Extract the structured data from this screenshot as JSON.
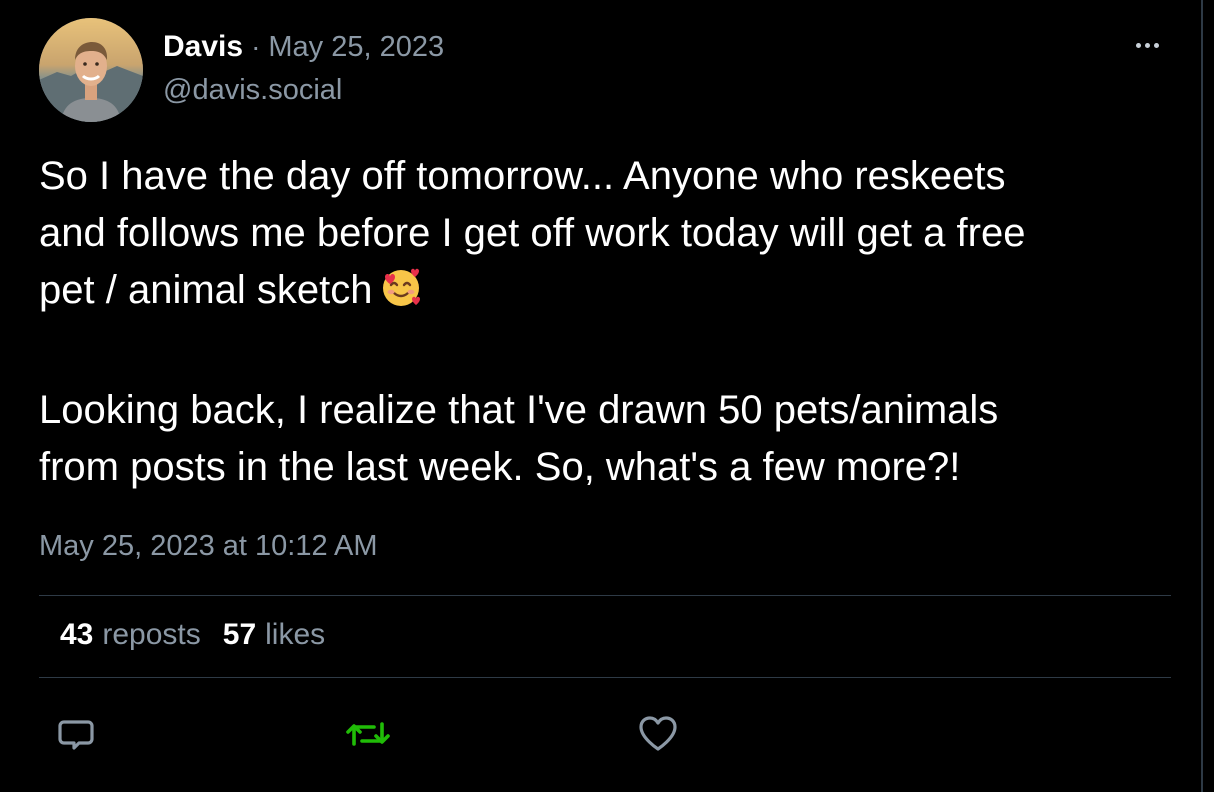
{
  "author": {
    "display_name": "Davis",
    "separator": "·",
    "post_date": "May 25, 2023",
    "handle": "@davis.social"
  },
  "post": {
    "paragraph_1_line_1": "So I have the day off tomorrow... Anyone who reskeets",
    "paragraph_1_line_2": "and follows me before I get off work today will get a free",
    "paragraph_1_line_3": "pet / animal sketch",
    "paragraph_2_line_1": "Looking back, I realize that I've drawn 50 pets/animals",
    "paragraph_2_line_2": "from posts in the last week. So, what's a few more?!",
    "emoji": "smiling-face-with-hearts-icon"
  },
  "timestamp": "May 25, 2023 at 10:12 AM",
  "stats": {
    "reposts_count": "43",
    "reposts_label": "reposts",
    "likes_count": "57",
    "likes_label": "likes"
  },
  "actions": {
    "reply_icon": "speech-bubble-icon",
    "repost_icon": "repost-arrows-icon",
    "like_icon": "heart-outline-icon"
  },
  "colors": {
    "background": "#000000",
    "primary_text": "#ffffff",
    "secondary_text": "#8b98a5",
    "divider": "#2e3a46",
    "repost_active": "#20bc07",
    "icon_muted": "#8b98a5"
  }
}
